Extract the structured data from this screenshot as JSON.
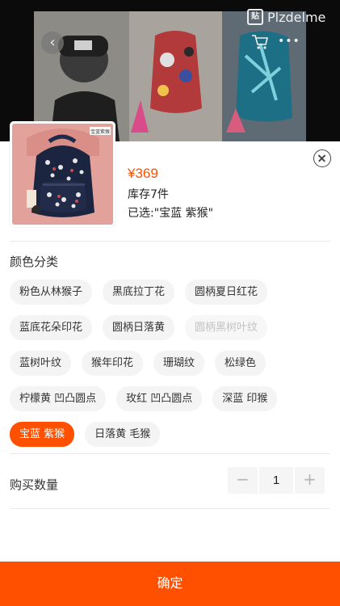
{
  "watermark": {
    "logo": "贴",
    "text": "Plzdelme"
  },
  "thumbnail": {
    "tag": "宝蓝紫猴"
  },
  "product": {
    "price": "¥369",
    "stock": "库存7件",
    "selected": "已选:\"宝蓝 紫猴\""
  },
  "color_section": {
    "title": "颜色分类",
    "options": [
      {
        "label": "粉色从林猴子",
        "state": "normal"
      },
      {
        "label": "黑底拉丁花",
        "state": "normal"
      },
      {
        "label": "圆柄夏日红花",
        "state": "normal"
      },
      {
        "label": "蓝底花朵印花",
        "state": "normal"
      },
      {
        "label": "圆柄日落黄",
        "state": "normal"
      },
      {
        "label": "圆柄黑树叶纹",
        "state": "disabled"
      },
      {
        "label": "蓝树叶纹",
        "state": "normal"
      },
      {
        "label": "猴年印花",
        "state": "normal"
      },
      {
        "label": "珊瑚纹",
        "state": "normal"
      },
      {
        "label": "松绿色",
        "state": "normal"
      },
      {
        "label": "柠檬黄 凹凸圆点",
        "state": "normal"
      },
      {
        "label": "玫红 凹凸圆点",
        "state": "normal"
      },
      {
        "label": "深蓝 印猴",
        "state": "normal"
      },
      {
        "label": "宝蓝 紫猴",
        "state": "selected"
      },
      {
        "label": "日落黄 毛猴",
        "state": "normal"
      }
    ]
  },
  "quantity": {
    "label": "购买数量",
    "value": "1",
    "minus": "−",
    "plus": "+"
  },
  "confirm_label": "确定",
  "colors": {
    "accent": "#ff5000",
    "chip_bg": "#f4f4f4",
    "disabled_text": "#c2c2c2"
  }
}
